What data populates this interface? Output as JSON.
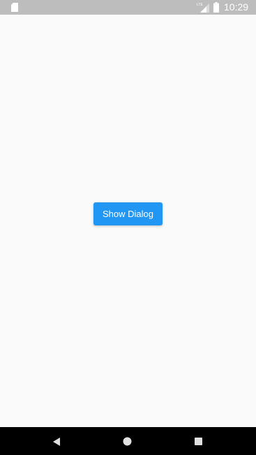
{
  "status_bar": {
    "time": "10:29",
    "network_label": "LTE",
    "icons": [
      "sd-card-icon",
      "lte-signal-icon",
      "battery-icon"
    ],
    "background_color": "#bdbdbd"
  },
  "main": {
    "show_dialog_button": {
      "label": "Show Dialog",
      "color": "#2196f3"
    }
  },
  "nav_bar": {
    "icons": [
      "back-icon",
      "home-icon",
      "recents-icon"
    ],
    "background_color": "#000000"
  }
}
